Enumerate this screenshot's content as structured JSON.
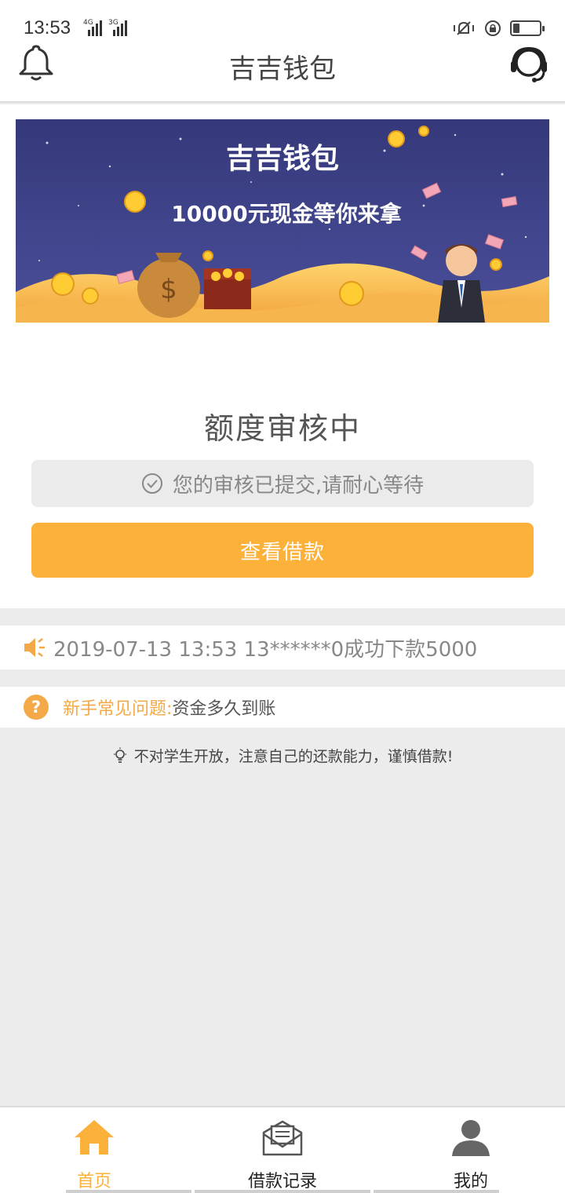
{
  "status_bar": {
    "time": "13:53",
    "network_1": "4G",
    "network_2": "3G"
  },
  "header": {
    "title": "吉吉钱包",
    "left_icon": "bell-icon",
    "right_icon": "customer-service-icon"
  },
  "banner": {
    "title": "吉吉钱包",
    "subtitle": "10000元现金等你来拿"
  },
  "review": {
    "title": "额度审核中",
    "submitted_text": "您的审核已提交,请耐心等待",
    "view_button": "查看借款"
  },
  "notice": {
    "text": "2019-07-13 13:53 13******0成功下款5000"
  },
  "faq": {
    "lead": "新手常见问题:",
    "question": "资金多久到账"
  },
  "tip": {
    "text": "不对学生开放，注意自己的还款能力，谨慎借款!"
  },
  "tabs": [
    {
      "label": "首页",
      "icon": "home-icon",
      "active": true
    },
    {
      "label": "借款记录",
      "icon": "mail-icon",
      "active": false
    },
    {
      "label": "我的",
      "icon": "user-icon",
      "active": false
    }
  ],
  "colors": {
    "accent": "#fcb23a",
    "faq_accent": "#f3a947",
    "banner_bg": "#3b3f7e"
  }
}
